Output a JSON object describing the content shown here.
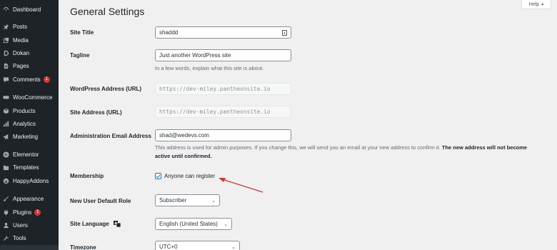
{
  "sidebar": {
    "items": [
      {
        "label": "Dashboard",
        "icon": "dashboard-icon"
      },
      {
        "label": "Posts",
        "icon": "pin-icon"
      },
      {
        "label": "Media",
        "icon": "media-icon"
      },
      {
        "label": "Dokan",
        "icon": "dokan-icon"
      },
      {
        "label": "Pages",
        "icon": "page-icon"
      },
      {
        "label": "Comments",
        "icon": "comment-icon",
        "badge": "1"
      },
      {
        "label": "WooCommerce",
        "icon": "woocommerce-icon"
      },
      {
        "label": "Products",
        "icon": "cube-icon"
      },
      {
        "label": "Analytics",
        "icon": "bar-chart-icon"
      },
      {
        "label": "Marketing",
        "icon": "megaphone-icon"
      },
      {
        "label": "Elementor",
        "icon": "elementor-icon"
      },
      {
        "label": "Templates",
        "icon": "folder-icon"
      },
      {
        "label": "HappyAddons",
        "icon": "smiley-icon"
      },
      {
        "label": "Appearance",
        "icon": "brush-icon"
      },
      {
        "label": "Plugins",
        "icon": "plug-icon",
        "badge": "1"
      },
      {
        "label": "Users",
        "icon": "user-icon"
      },
      {
        "label": "Tools",
        "icon": "wrench-icon"
      }
    ]
  },
  "header": {
    "title": "General Settings",
    "help_label": "Help"
  },
  "form": {
    "site_title": {
      "label": "Site Title",
      "value": "shaddd"
    },
    "tagline": {
      "label": "Tagline",
      "value": "Just another WordPress site",
      "description": "In a few words, explain what this site is about."
    },
    "wp_address": {
      "label": "WordPress Address (URL)",
      "value": "https://dev-miley.pantheonsite.io"
    },
    "site_address": {
      "label": "Site Address (URL)",
      "value": "https://dev-miley.pantheonsite.io"
    },
    "admin_email": {
      "label": "Administration Email Address",
      "value": "shad@wedevs.com",
      "description": "This address is used for admin purposes. If you change this, we will send you an email at your new address to confirm it.",
      "description_bold": "The new address will not become active until confirmed."
    },
    "membership": {
      "label": "Membership",
      "checkbox_label": "Anyone can register",
      "checked": true
    },
    "default_role": {
      "label": "New User Default Role",
      "value": "Subscriber"
    },
    "site_language": {
      "label": "Site Language",
      "value": "English (United States)"
    },
    "timezone": {
      "label": "Timezone",
      "value": "UTC+0"
    }
  },
  "colors": {
    "sidebar_bg": "#1d2327",
    "accent": "#2271b1",
    "badge": "#d63638",
    "annotation_arrow": "#d63638"
  }
}
